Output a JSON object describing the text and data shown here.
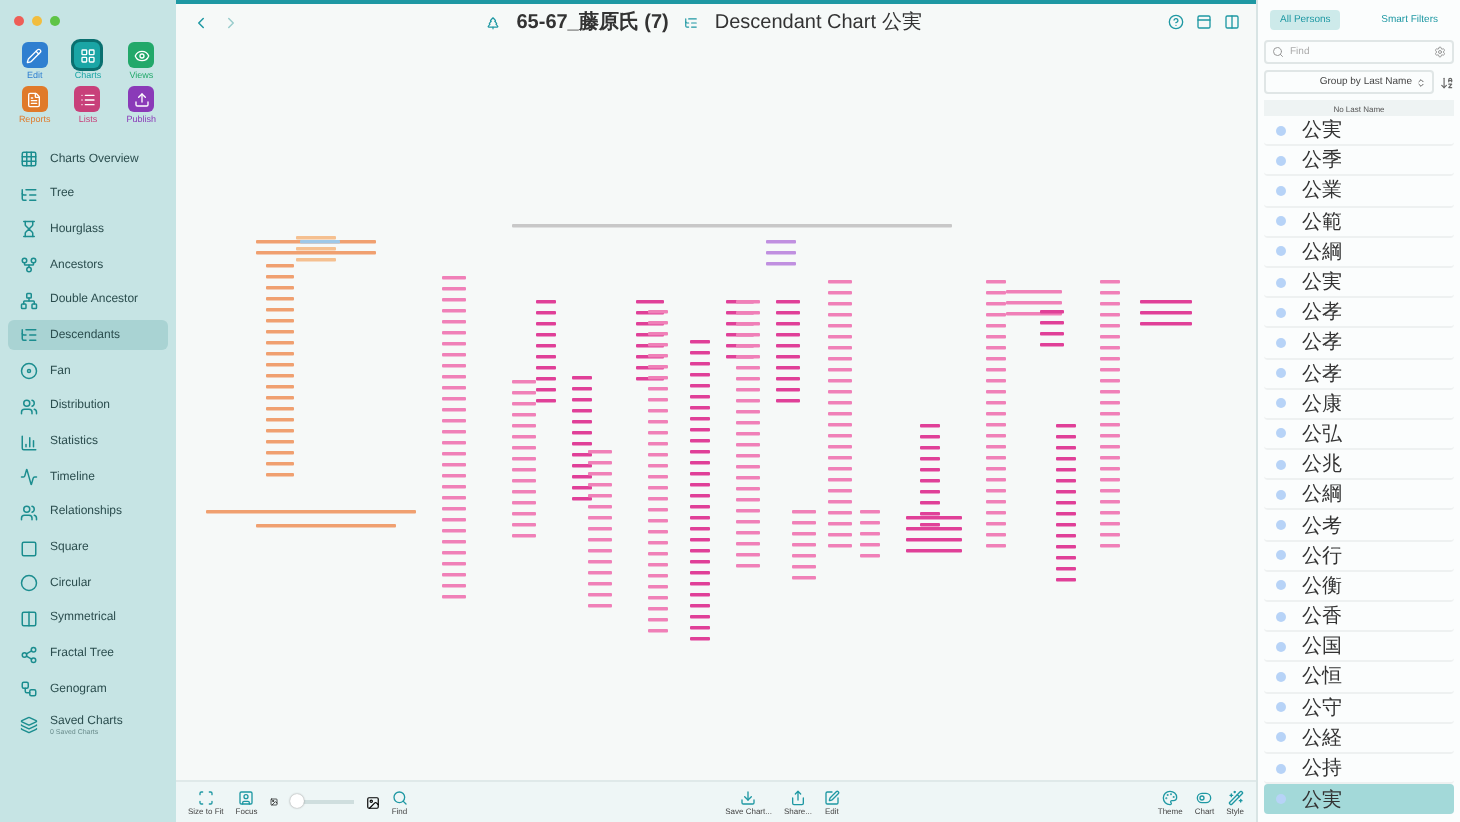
{
  "sidebar": {
    "tools": [
      {
        "label": "Edit",
        "kind": "edit",
        "color": "#2f7fd0",
        "selected": false
      },
      {
        "label": "Charts",
        "kind": "charts",
        "color": "#1aa5a5",
        "selected": true
      },
      {
        "label": "Views",
        "kind": "views",
        "color": "#22a86a",
        "selected": false
      },
      {
        "label": "Reports",
        "kind": "reports",
        "color": "#e07a2a",
        "selected": false
      },
      {
        "label": "Lists",
        "kind": "lists",
        "color": "#c8407a",
        "selected": false
      },
      {
        "label": "Publish",
        "kind": "publish",
        "color": "#8a3ab8",
        "selected": false
      }
    ],
    "items": [
      {
        "label": "Charts Overview",
        "kind": "overview",
        "selected": false
      },
      {
        "label": "Tree",
        "kind": "tree",
        "selected": false
      },
      {
        "label": "Hourglass",
        "kind": "hourglass",
        "selected": false
      },
      {
        "label": "Ancestors",
        "kind": "ancestors",
        "selected": false
      },
      {
        "label": "Double Ancestor",
        "kind": "double",
        "selected": false
      },
      {
        "label": "Descendants",
        "kind": "descendants",
        "selected": true
      },
      {
        "label": "Fan",
        "kind": "fan",
        "selected": false
      },
      {
        "label": "Distribution",
        "kind": "distribution",
        "selected": false
      },
      {
        "label": "Statistics",
        "kind": "statistics",
        "selected": false
      },
      {
        "label": "Timeline",
        "kind": "timeline",
        "selected": false
      },
      {
        "label": "Relationships",
        "kind": "relationships",
        "selected": false
      },
      {
        "label": "Square",
        "kind": "square",
        "selected": false
      },
      {
        "label": "Circular",
        "kind": "circular",
        "selected": false
      },
      {
        "label": "Symmetrical",
        "kind": "symmetrical",
        "selected": false
      },
      {
        "label": "Fractal Tree",
        "kind": "fractal",
        "selected": false
      },
      {
        "label": "Genogram",
        "kind": "genogram",
        "selected": false
      }
    ],
    "saved": {
      "label": "Saved Charts",
      "count": "0 Saved Charts"
    }
  },
  "toolbar": {
    "database": "65-67_藤原氏 (7)",
    "chart_title": "Descendant Chart 公実"
  },
  "bottom_bar": {
    "left": [
      {
        "label": "Size to Fit",
        "kind": "fit"
      },
      {
        "label": "Focus",
        "kind": "focus"
      }
    ],
    "zoom": {
      "level": 0.12
    },
    "find": {
      "label": "Find",
      "kind": "find"
    },
    "center": [
      {
        "label": "Save Chart...",
        "kind": "save"
      },
      {
        "label": "Share...",
        "kind": "share"
      },
      {
        "label": "Edit",
        "kind": "edit"
      }
    ],
    "right": [
      {
        "label": "Theme",
        "kind": "theme"
      },
      {
        "label": "Chart",
        "kind": "chart"
      },
      {
        "label": "Style",
        "kind": "style"
      }
    ]
  },
  "persons": {
    "tabs": [
      {
        "label": "All Persons",
        "selected": true
      },
      {
        "label": "Smart Filters",
        "selected": false
      }
    ],
    "search": {
      "placeholder": "Find"
    },
    "group_by": "Group by Last Name",
    "section": "No Last Name",
    "rows": [
      {
        "name": "公実",
        "selected": false
      },
      {
        "name": "公季",
        "selected": false
      },
      {
        "name": "公業",
        "selected": false
      },
      {
        "name": "公範",
        "selected": false
      },
      {
        "name": "公綱",
        "selected": false
      },
      {
        "name": "公実",
        "selected": false
      },
      {
        "name": "公孝",
        "selected": false
      },
      {
        "name": "公孝",
        "selected": false
      },
      {
        "name": "公孝",
        "selected": false
      },
      {
        "name": "公康",
        "selected": false
      },
      {
        "name": "公弘",
        "selected": false
      },
      {
        "name": "公兆",
        "selected": false
      },
      {
        "name": "公綱",
        "selected": false
      },
      {
        "name": "公考",
        "selected": false
      },
      {
        "name": "公行",
        "selected": false
      },
      {
        "name": "公衡",
        "selected": false
      },
      {
        "name": "公香",
        "selected": false
      },
      {
        "name": "公国",
        "selected": false
      },
      {
        "name": "公恒",
        "selected": false
      },
      {
        "name": "公守",
        "selected": false
      },
      {
        "name": "公経",
        "selected": false
      },
      {
        "name": "公持",
        "selected": false
      },
      {
        "name": "公実",
        "selected": true
      }
    ]
  }
}
